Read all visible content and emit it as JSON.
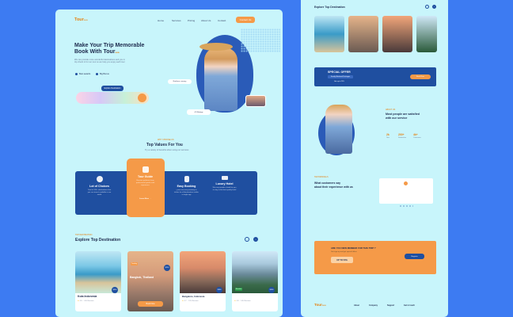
{
  "brand": {
    "name_part1": "Tour",
    "name_part2": "sea"
  },
  "nav": {
    "items": [
      "Home",
      "Services",
      "Pricing",
      "About Us",
      "Contact"
    ],
    "cta": "Contact Us"
  },
  "hero": {
    "title_line1": "Make Your Trip Memorable",
    "title_line2": "Book With Tour",
    "title_accent": "sea",
    "desc": "We can provide more wonderful destinations and you in trip check in for our tour so we help you enjoy each tour",
    "checks": [
      "Best awards",
      "Big Bonus"
    ],
    "cta": "Explore Destination",
    "badge": "Northern scenery",
    "rating": "4.9 Ratings"
  },
  "values": {
    "kicker": "WHY CHOOSE US",
    "title": "Top Values For You",
    "subtitle": "Try a variety of benefits when using our services",
    "items": [
      {
        "name": "Lot of Choices",
        "desc": "Total of 100+ destinations that you can travel, available in our world"
      },
      {
        "name": "Tour Guide",
        "desc": "Receive guidance from professional guides with experience"
      },
      {
        "name": "Easy Booking",
        "desc": "Quick and easy booking of tickets for all destinations within a single app"
      },
      {
        "name": "Luxury Hotel",
        "desc": "We can provide a hotel for you to stay in the best quality hotel"
      }
    ],
    "learn_more": "Learn More →"
  },
  "destinations": {
    "kicker": "TOP DESTINATION",
    "title": "Explore Top Destination",
    "items": [
      {
        "name": "Kuta Indonesia",
        "rating": "4.8",
        "reviews": "1.4k Reviews",
        "price": "$360",
        "tag": ""
      },
      {
        "name": "Bangkok, Thailand",
        "rating": "4.9",
        "reviews": "1.2k Reviews",
        "price": "$255",
        "tag": "Trending"
      },
      {
        "name": "Bangalore, Indonesia",
        "rating": "4.7",
        "reviews": "1.2k Reviews",
        "price": "$386",
        "tag": ""
      },
      {
        "name": "Mountain",
        "rating": "4.8",
        "reviews": "1.4k Reviews",
        "price": "$396",
        "tag": "Mountain"
      }
    ],
    "book_label": "Book Now"
  },
  "right": {
    "dest_title": "Explore Top Destination",
    "offer_title": "SPECIAL OFFER",
    "offer_desc": "Family Weekend Packages",
    "offer_off": "Get up to 25%",
    "offer_cta": "Book Now",
    "about_kicker": "ABOUT US",
    "about_title_l1": "Most people are satisfied",
    "about_title_l2": "with our service",
    "stats": [
      {
        "v": "2k",
        "l": "Tour"
      },
      {
        "v": "200+",
        "l": "Destination"
      },
      {
        "v": "4k+",
        "l": "Customers"
      }
    ],
    "testi_kicker": "TESTIMONIALS",
    "testi_title_l1": "What customers say",
    "testi_title_l2": "about their experience with us",
    "newsletter_title": "ARE YOU NEW MEMBER FOR THIS TRIP ?",
    "newsletter_desc": "Get sign-up and get special offers",
    "newsletter_off": "UP TO 50%",
    "newsletter_cta": "Register",
    "footer_cols": [
      "About",
      "Company",
      "Support",
      "Get in touch"
    ]
  },
  "colors": {
    "accent": "#f59a48",
    "brand": "#1f4fa0",
    "page": "#c8f5fb",
    "outer": "#3d7bf2"
  }
}
